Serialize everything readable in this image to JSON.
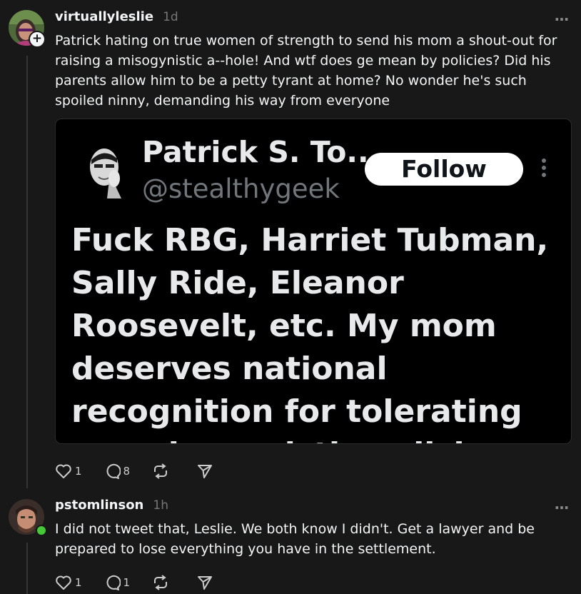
{
  "posts": [
    {
      "username": "virtuallyleslie",
      "time": "1d",
      "more_icon": "…",
      "text": "Patrick hating on true women of strength to send his mom a shout-out for raising a misogynistic a--hole! And wtf does ge mean by policies? Did his parents allow him to be a petty tyrant at home? No wonder he's such spoiled ninny, demanding his way from everyone",
      "follow_badge": "+",
      "embed": {
        "name": "Patrick S. To...",
        "handle": "@stealthygeek",
        "follow_label": "Follow",
        "body": "Fuck RBG, Harriet Tubman, Sally Ride, Eleanor Roosevelt, etc. My mom deserves national recognition for tolerating my misogynistic policies."
      },
      "likes": "1",
      "replies": "8"
    },
    {
      "username": "pstomlinson",
      "time": "1h",
      "more_icon": "…",
      "text": "I did not tweet that, Leslie. We both know I didn't. Get a lawyer and be prepared to lose everything you have in the settlement.",
      "likes": "1",
      "replies": "1"
    }
  ],
  "icons": [
    "heart-icon",
    "comment-icon",
    "repost-icon",
    "share-icon"
  ],
  "colors": {
    "background": "#181818",
    "text": "#f3f5f7",
    "muted": "#777777",
    "online": "#45c937",
    "embed_bg": "#000000"
  }
}
